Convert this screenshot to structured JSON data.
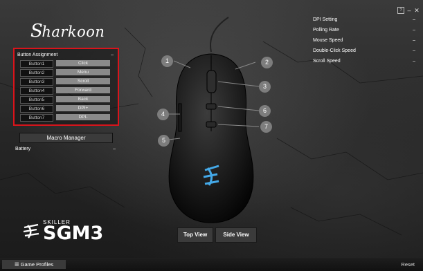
{
  "app": {
    "logo_text": "harkoon",
    "logo_mark": "S",
    "icons": {
      "help": "help-icon",
      "minimize": "minimize-icon",
      "close": "close-icon"
    },
    "window": {
      "help": "?",
      "minimize": "–",
      "close": "✕"
    }
  },
  "button_assignment": {
    "title": "Button Assignment",
    "collapse": "–",
    "rows": [
      {
        "name": "Button1",
        "func": "Click"
      },
      {
        "name": "Button2",
        "func": "Menu"
      },
      {
        "name": "Button3",
        "func": "Scroll"
      },
      {
        "name": "Button4",
        "func": "Forward"
      },
      {
        "name": "Button5",
        "func": "Back"
      },
      {
        "name": "Button6",
        "func": "DPI+"
      },
      {
        "name": "Button7",
        "func": "DPI-"
      }
    ]
  },
  "macro_manager": "Macro Manager",
  "battery": {
    "label": "Battery",
    "collapse": "–"
  },
  "settings": [
    {
      "label": "DPI Setting",
      "collapse": "–"
    },
    {
      "label": "Polling Rate",
      "collapse": "–"
    },
    {
      "label": "Mouse Speed",
      "collapse": "–"
    },
    {
      "label": "Double-Click Speed",
      "collapse": "–"
    },
    {
      "label": "Scroll Speed",
      "collapse": "–"
    }
  ],
  "brand": {
    "skiller": "SKILLER",
    "model": "SGM3"
  },
  "views": {
    "top": "Top View",
    "side": "Side View"
  },
  "callouts": [
    "1",
    "2",
    "3",
    "4",
    "5",
    "6",
    "7"
  ],
  "bottom": {
    "game_profiles": "☰ Game Profiles",
    "reset": "Reset"
  }
}
